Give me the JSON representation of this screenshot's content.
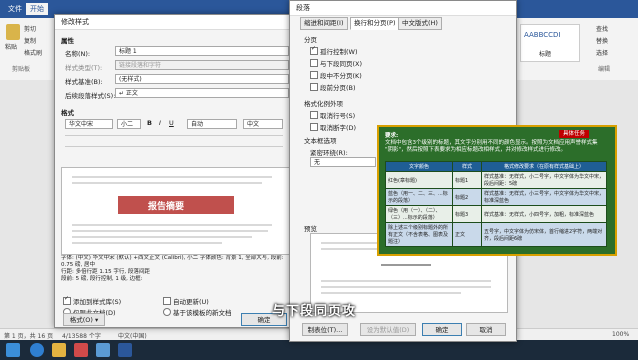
{
  "word": {
    "tabs": [
      "文件",
      "开始"
    ],
    "ribbon_left": {
      "paste": "粘贴",
      "cut": "剪切",
      "copy": "复制",
      "painter": "格式刷",
      "clipboard": "剪贴板"
    },
    "ribbon_right": {
      "find": "查找",
      "replace": "替换",
      "select": "选择",
      "edit_group": "编辑",
      "style_sample": "AABBCCDI",
      "style_name": "标题"
    },
    "status": {
      "page": "第 1 页，共 16 页",
      "words": "4/13588 个字",
      "lang": "中文(中国)",
      "zoom": "100%"
    }
  },
  "modify_style": {
    "title": "修改样式",
    "section_props": "属性",
    "name_label": "名称(N):",
    "name_value": "标题 1",
    "type_label": "样式类型(T):",
    "type_value": "链接段落和字符",
    "based_label": "样式基准(B):",
    "based_value": "(无样式)",
    "follow_label": "后续段落样式(S):",
    "follow_value": "↵ 正文",
    "section_format": "格式",
    "font_value": "华文中宋",
    "size_value": "小二",
    "lang_value": "中文",
    "bold": "B",
    "italic": "I",
    "underline": "U",
    "auto": "自动",
    "preview_heading": "报告摘要",
    "desc": "字体: (中文) 华文中宋 (默认) +西文正文 (Calibri), 小二 字体颜色: 背景 1, 全部大写, 段前: 0.75 磅, 居中\n行距: 多倍行距 1.15 字行, 段落间距\n段前: 5 磅, 段行控制, 1 级, 边框:",
    "add_gallery": "添加到样式库(S)",
    "auto_update": "自动更新(U)",
    "only_doc": "仅限此文档(D)",
    "new_doc": "基于该模板的新文档",
    "format_btn": "格式(O) ▾",
    "ok": "确定",
    "cancel": "取消"
  },
  "paragraph": {
    "title": "段落",
    "tabs": [
      "缩进和间距(I)",
      "换行和分页(P)",
      "中文版式(H)"
    ],
    "section_pagination": "分页",
    "opt1": "孤行控制(W)",
    "opt2": "与下段同页(X)",
    "opt3": "段中不分页(K)",
    "opt4": "段前分页(B)",
    "section_format": "格式化例外项",
    "opt5": "取消行号(S)",
    "opt6": "取消断字(D)",
    "section_textbox": "文本框选项",
    "tight_label": "紧密环绕(R):",
    "tight_value": "无",
    "section_preview": "预览",
    "tabs_btn": "制表位(T)...",
    "default_btn": "设为默认值(D)",
    "ok": "确定",
    "cancel": "取消"
  },
  "requirement": {
    "title": "要求:",
    "badge": "具体任务",
    "text": "文档中包含3个级别的标题，其文字分别用不同的颜色显示。按照为文档应用声誉样式集 \"阴影\"，然后按照下表要求为相应标题改相样式，并对修改样式进行修改。",
    "headers": [
      "文字颜色",
      "样式",
      "格式修改要求（在原有样式基础上）"
    ],
    "rows": [
      [
        "红色(章标题)",
        "标题1",
        "样式基准：无样式，小二号字，中文字体为华文中宋，段后间距：5磅"
      ],
      [
        "蓝色（用一、二、三、...标示的段落）",
        "标题2",
        "样式基准：无样式，小三号字，中文字体为华文中宋，标准深蓝色"
      ],
      [
        "绿色（用（一）、（二）、（三）...标示的段落）",
        "标题3",
        "样式基准：无样式，小四号字，加粗，标准深蓝色"
      ],
      [
        "除上述三个级别标题外的所有正文（不含表格、图表及题注）",
        "正文",
        "五号字，中文字体为仿宋体，首行缩进2字符，两端对齐，段后间距6磅"
      ]
    ]
  },
  "subtitle": "与下段同页攻"
}
